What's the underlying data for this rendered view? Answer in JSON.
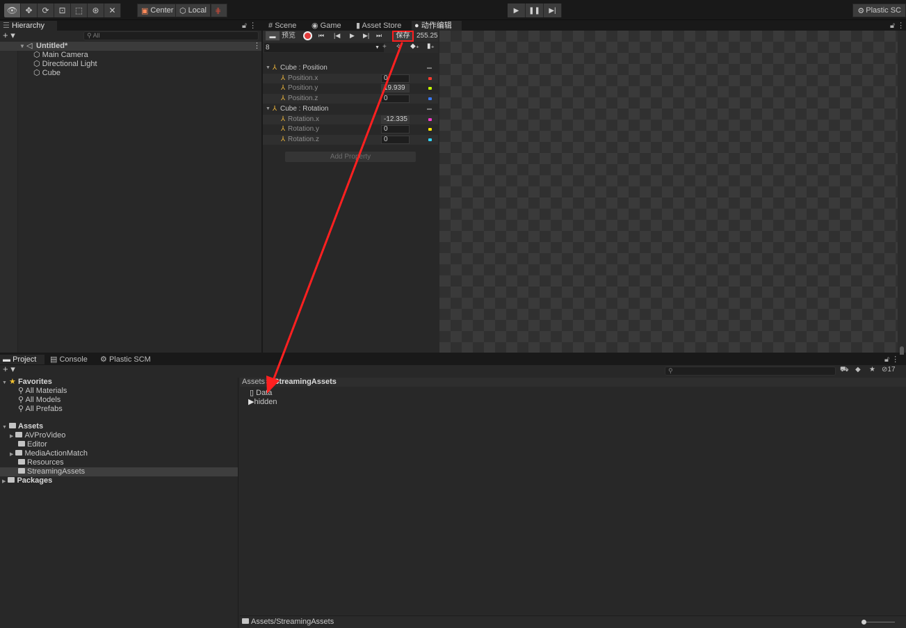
{
  "toolbar": {
    "pivot_center": "Center",
    "pivot_local": "Local",
    "plastic": "Plastic SC"
  },
  "hierarchy": {
    "tab": "Hierarchy",
    "search_placeholder": "All",
    "scene": "Untitled*",
    "items": [
      "Main Camera",
      "Directional Light",
      "Cube"
    ]
  },
  "anim": {
    "tabs": [
      "Scene",
      "Game",
      "Asset Store",
      "动作编辑"
    ],
    "preview": "预览",
    "save": "保存",
    "frame_value": "255.25",
    "clip_field": "8",
    "groups": [
      {
        "name": "Cube : Position",
        "props": [
          {
            "name": "Position.x",
            "value": "0",
            "color": "#ff3b30"
          },
          {
            "name": "Position.y",
            "value": "19.939",
            "color": "#c6ff00"
          },
          {
            "name": "Position.z",
            "value": "0",
            "color": "#3a7bff"
          }
        ]
      },
      {
        "name": "Cube : Rotation",
        "props": [
          {
            "name": "Rotation.x",
            "value": "-12.335",
            "color": "#ff3bd0"
          },
          {
            "name": "Rotation.y",
            "value": "0",
            "color": "#ffe600"
          },
          {
            "name": "Rotation.z",
            "value": "0",
            "color": "#33d6ff"
          }
        ]
      }
    ],
    "add_property": "Add Property"
  },
  "project": {
    "tabs": [
      "Project",
      "Console",
      "Plastic SCM"
    ],
    "hidden_count": "17",
    "favorites": "Favorites",
    "fav_items": [
      "All Materials",
      "All Models",
      "All Prefabs"
    ],
    "assets": "Assets",
    "asset_folders": [
      "AVProVideo",
      "Editor",
      "MediaActionMatch",
      "Resources",
      "StreamingAssets"
    ],
    "packages": "Packages",
    "breadcrumb_root": "Assets",
    "breadcrumb_current": "StreamingAssets",
    "files": [
      "Data",
      "hidden"
    ],
    "status_path": "Assets/StreamingAssets"
  },
  "colors": {
    "highlight": "#ff1f1f",
    "annotation_arrow": "#ff2020"
  }
}
